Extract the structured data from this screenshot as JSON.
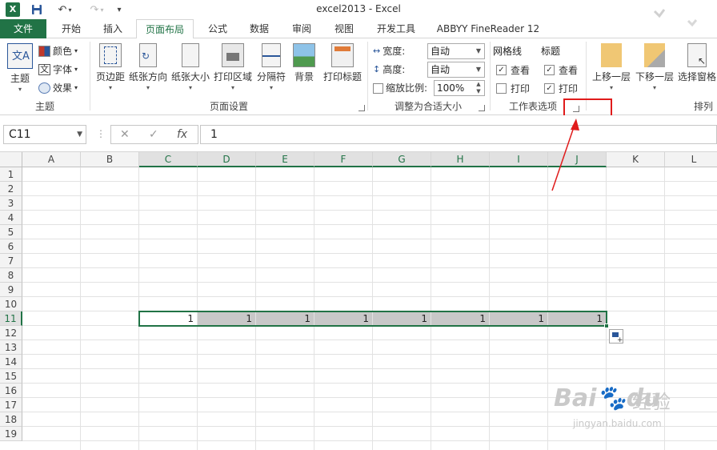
{
  "title": "excel2013 - Excel",
  "tabs": [
    "文件",
    "开始",
    "插入",
    "页面布局",
    "公式",
    "数据",
    "审阅",
    "视图",
    "开发工具",
    "ABBYY FineReader 12"
  ],
  "ribbon": {
    "theme_group": {
      "label": "主题",
      "themes_btn": "主题",
      "colors": "颜色",
      "fonts": "字体",
      "effects": "效果"
    },
    "page_setup": {
      "label": "页面设置",
      "margins": "页边距",
      "orientation": "纸张方向",
      "size": "纸张大小",
      "print_area": "打印区域",
      "breaks": "分隔符",
      "background": "背景",
      "print_titles": "打印标题"
    },
    "scale_to_fit": {
      "label": "调整为合适大小",
      "width_label": "宽度:",
      "width_value": "自动",
      "height_label": "高度:",
      "height_value": "自动",
      "scale_label": "缩放比例:",
      "scale_value": "100%"
    },
    "sheet_options": {
      "label": "工作表选项",
      "gridlines": "网格线",
      "headings": "标题",
      "view": "查看",
      "print": "打印",
      "gridlines_view": true,
      "gridlines_print": false,
      "headings_view": true,
      "headings_print": true
    },
    "arrange": {
      "label": "排列",
      "bring_forward": "上移一层",
      "send_backward": "下移一层",
      "selection_pane": "选择窗格"
    }
  },
  "formula_bar": {
    "name_box": "C11",
    "cancel": "✕",
    "enter": "✓",
    "fx": "fx",
    "value": "1"
  },
  "columns": [
    "A",
    "B",
    "C",
    "D",
    "E",
    "F",
    "G",
    "H",
    "I",
    "J",
    "K",
    "L"
  ],
  "rows": [
    "1",
    "2",
    "3",
    "4",
    "5",
    "6",
    "7",
    "8",
    "9",
    "10",
    "11",
    "12",
    "13",
    "14",
    "15",
    "16",
    "17",
    "18",
    "19"
  ],
  "row11_values": [
    "1",
    "1",
    "1",
    "1",
    "1",
    "1",
    "1",
    "1"
  ],
  "colors": {
    "excel_green": "#217346",
    "highlight_red": "#e01b1b"
  },
  "watermark": {
    "brand": "Bai",
    "brand_suffix": "du",
    "site": "经验",
    "url": "jingyan.baidu.com"
  }
}
